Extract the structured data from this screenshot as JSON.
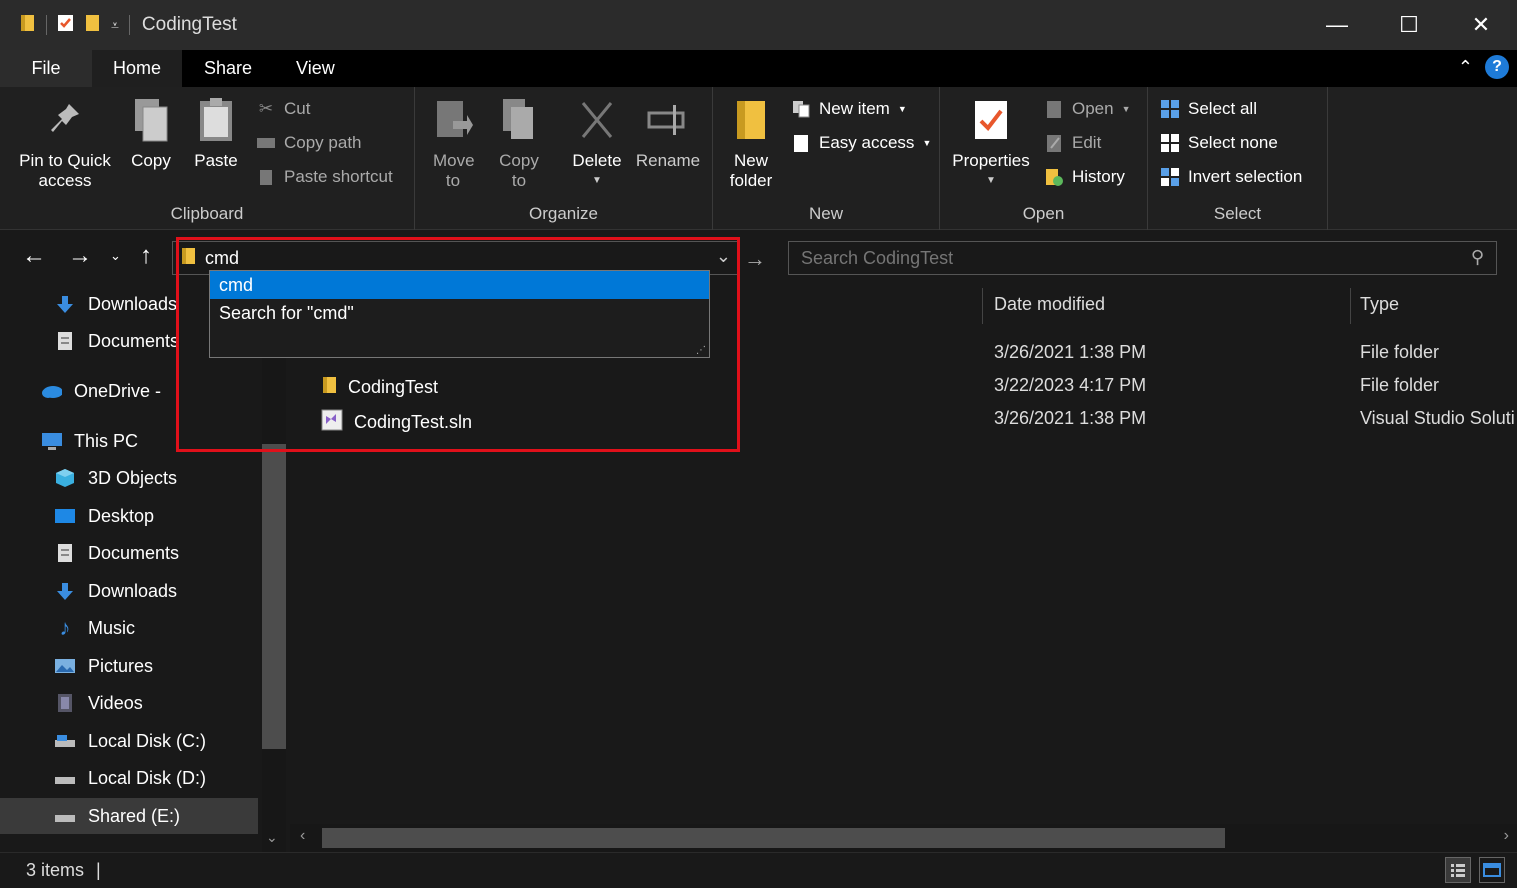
{
  "window": {
    "title": "CodingTest",
    "controls": {
      "minimize": "—",
      "maximize": "☐",
      "close": "✕"
    }
  },
  "ribbon_tabs": [
    "File",
    "Home",
    "Share",
    "View"
  ],
  "ribbon": {
    "clipboard": {
      "label": "Clipboard",
      "pin": "Pin to Quick access",
      "copy": "Copy",
      "paste": "Paste",
      "cut": "Cut",
      "copy_path": "Copy path",
      "paste_shortcut": "Paste shortcut"
    },
    "organize": {
      "label": "Organize",
      "move_to": "Move to",
      "copy_to": "Copy to",
      "delete": "Delete",
      "rename": "Rename"
    },
    "new": {
      "label": "New",
      "new_folder": "New folder",
      "new_item": "New item",
      "easy_access": "Easy access"
    },
    "open": {
      "label": "Open",
      "properties": "Properties",
      "open": "Open",
      "edit": "Edit",
      "history": "History"
    },
    "select": {
      "label": "Select",
      "select_all": "Select all",
      "select_none": "Select none",
      "invert_selection": "Invert selection"
    }
  },
  "address": {
    "value": "cmd",
    "suggestions": [
      "cmd",
      "Search for \"cmd\""
    ]
  },
  "search": {
    "placeholder": "Search CodingTest"
  },
  "sidebar": {
    "items": [
      "Downloads",
      "Documents",
      "OneDrive - ",
      "This PC",
      "3D Objects",
      "Desktop",
      "Documents",
      "Downloads",
      "Music",
      "Pictures",
      "Videos",
      "Local Disk (C:)",
      "Local Disk (D:)",
      "Shared (E:)"
    ]
  },
  "columns": {
    "date": "Date modified",
    "type": "Type"
  },
  "files": [
    {
      "name": "",
      "date": "3/26/2021 1:38 PM",
      "type": "File folder"
    },
    {
      "name": "CodingTest",
      "date": "3/22/2023 4:17 PM",
      "type": "File folder"
    },
    {
      "name": "CodingTest.sln",
      "date": "3/26/2021 1:38 PM",
      "type": "Visual Studio Soluti"
    }
  ],
  "status": {
    "items": "3 items"
  },
  "colors": {
    "accent": "#0078d7",
    "highlight": "#e0101a",
    "folder": "#f0c040"
  }
}
